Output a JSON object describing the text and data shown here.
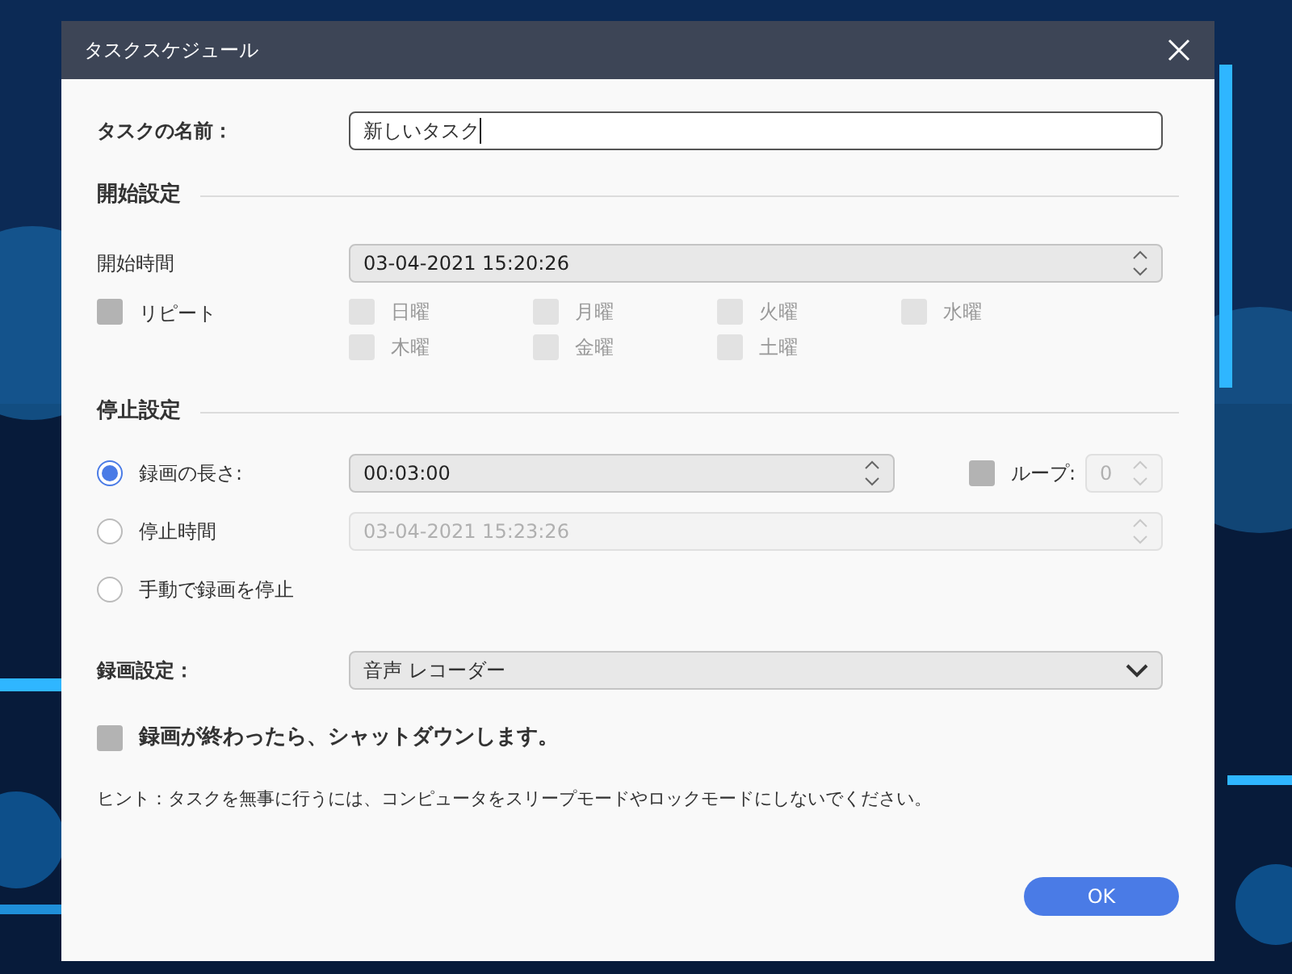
{
  "window": {
    "title": "タスクスケジュール"
  },
  "task_name": {
    "label": "タスクの名前：",
    "value": "新しいタスク"
  },
  "start": {
    "heading": "開始設定",
    "time_label": "開始時間",
    "time_value": "03-04-2021 15:20:26",
    "repeat": {
      "label": "リピート",
      "checked": false
    },
    "days": [
      {
        "label": "日曜",
        "checked": false,
        "disabled": true
      },
      {
        "label": "月曜",
        "checked": false,
        "disabled": true
      },
      {
        "label": "火曜",
        "checked": false,
        "disabled": true
      },
      {
        "label": "水曜",
        "checked": false,
        "disabled": true
      },
      {
        "label": "木曜",
        "checked": false,
        "disabled": true
      },
      {
        "label": "金曜",
        "checked": false,
        "disabled": true
      },
      {
        "label": "土曜",
        "checked": false,
        "disabled": true
      }
    ]
  },
  "stop": {
    "heading": "停止設定",
    "options": [
      {
        "label": "録画の長さ:",
        "selected": true,
        "value": "00:03:00",
        "disabled": false
      },
      {
        "label": "停止時間",
        "selected": false,
        "value": "03-04-2021 15:23:26",
        "disabled": true
      },
      {
        "label": "手動で録画を停止",
        "selected": false
      }
    ],
    "loop": {
      "label": "ループ:",
      "checked": false,
      "value": "0",
      "disabled": true
    }
  },
  "recording": {
    "label": "録画設定：",
    "value": "音声 レコーダー"
  },
  "shutdown": {
    "label": "録画が終わったら、シャットダウンします。",
    "checked": false
  },
  "hint": "ヒント：タスクを無事に行うには、コンピュータをスリープモードやロックモードにしないでください。",
  "buttons": [
    "OK"
  ]
}
